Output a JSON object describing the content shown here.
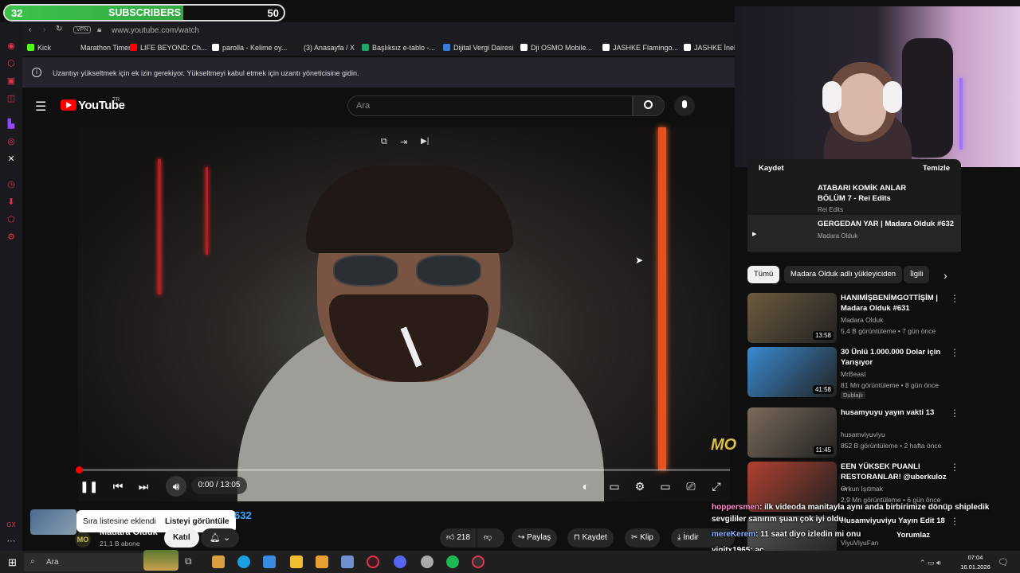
{
  "sub_goal": {
    "current": "32",
    "label": "SUBSCRIBERS",
    "target": "50",
    "progress": 0.64
  },
  "browser": {
    "vpn": "VPN",
    "url": "www.youtube.com/watch",
    "bookmarks": [
      {
        "label": "Kick",
        "color": "#53fc18"
      },
      {
        "label": "Marathon Timer",
        "color": "#1c1c20"
      },
      {
        "label": "LIFE BEYOND: Ch...",
        "color": "#ff0000"
      },
      {
        "label": "parolla - Kelime oy...",
        "color": "#ffffff"
      },
      {
        "label": "(3) Anasayfa / X",
        "color": "#1c1c20"
      },
      {
        "label": "Başlıksız e-tablo -...",
        "color": "#23a566"
      },
      {
        "label": "Dijital Vergi Dairesi",
        "color": "#3a7bd5"
      },
      {
        "label": "Dji OSMO Mobile...",
        "color": "#ffffff"
      },
      {
        "label": "JASHKE Flamingo...",
        "color": "#ffffff"
      },
      {
        "label": "JASHKE İnek",
        "color": "#ffffff"
      }
    ],
    "info_message": "Uzantıyı yükseltmek için ek izin gerekiyor. Yükseltmeyi kabul etmek için uzantı yöneticisine gidin."
  },
  "youtube": {
    "logo": "YouTube",
    "region": "TR",
    "search_placeholder": "Ara",
    "player": {
      "time": "0:00 / 13:05",
      "channel_watermark": "MO"
    },
    "toast": {
      "message": "Sıra listesine eklendi",
      "action": "Listeyi görüntüle"
    },
    "video_title_fragment": "632",
    "channel": {
      "name": "Madara Olduk",
      "subs": "21,1 B abone",
      "join": "Katıl"
    },
    "actions": {
      "likes": "218",
      "share": "Paylaş",
      "save": "Kaydet",
      "clip": "Klip",
      "download": "İndir"
    },
    "playlist": {
      "save": "Kaydet",
      "clear": "Temizle",
      "items": [
        {
          "title": "ATABARI KOMİK ANLAR BÖLÜM 7 - Rei Edits",
          "channel": "Rei Edits"
        },
        {
          "title": "GERGEDAN YAR | Madara Olduk #632",
          "channel": "Madara Olduk"
        }
      ]
    },
    "chips": [
      "Tümü",
      "Madara Olduk adlı yükleyiciden",
      "İlgili"
    ],
    "recommendations": [
      {
        "title": "HANIMİŞBENİMGOTTİŞİM | Madara Olduk #631",
        "channel": "Madara Olduk",
        "meta": "5,4 B görüntüleme • 7 gün önce",
        "duration": "13:58",
        "badge": "",
        "color": "#6b5a3e"
      },
      {
        "title": "30 Ünlü 1.000.000 Dolar için Yarışıyor",
        "channel": "MrBeast",
        "meta": "81 Mn görüntüleme • 8 gün önce",
        "duration": "41:58",
        "badge": "Dublajlı",
        "color": "#3a8ad0"
      },
      {
        "title": "husamyuyu yayın vakti 13",
        "channel": "husamviyuviyu",
        "meta": "852 B görüntüleme • 2 hafta önce",
        "duration": "11:45",
        "badge": "",
        "color": "#7a6a5a"
      },
      {
        "title": "EEN YÜKSEK PUANLI RESTORANLAR! @uberkuloz ...",
        "channel": "Orkun Işıtmak",
        "meta": "2,9 Mn görüntüleme • 6 gün önce",
        "duration": "",
        "badge": "",
        "color": "#b04030"
      },
      {
        "title": "Husamviyuviyu Yayın Edit 18",
        "channel": "ViyuViyuFan",
        "meta": "",
        "duration": "",
        "badge": "",
        "color": "#555555"
      }
    ]
  },
  "chat": [
    {
      "user": "hoppersmen",
      "text": ": ilk videoda manitayla aynı anda birbirimize dönüp shipledik",
      "color": "#ff8fd0"
    },
    {
      "user": "",
      "text": "sevgililer sanırım şuan çok iyi oldu",
      "color": "#ffffff"
    },
    {
      "user": "mereKerem",
      "text": ": 11 saat diyo izledin mi onu",
      "color": "#8fb0ff"
    },
    {
      "user": "yigitx1965",
      "text": ": ac",
      "color": "#ffffff"
    },
    {
      "user": "HUMMERJEPP",
      "text": ": selen özyurt",
      "color": "#7dff7d"
    }
  ],
  "yorumlaz": "Yorumlaz",
  "taskbar": {
    "search": "Ara",
    "time": "07:04",
    "date": "16.01.2026"
  }
}
